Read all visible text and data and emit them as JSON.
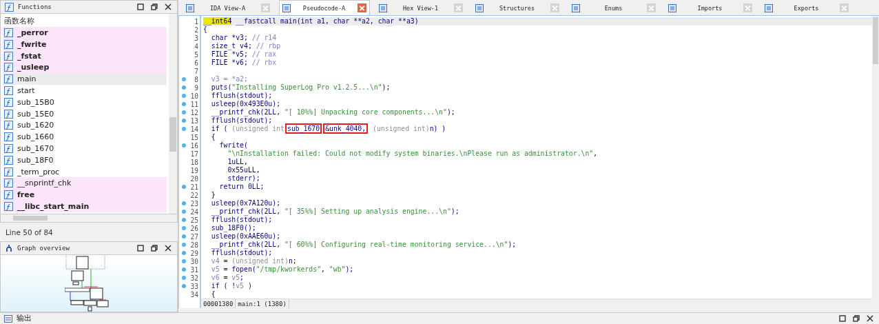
{
  "functions_panel": {
    "title": "Functions",
    "column_header": "函数名称",
    "items": [
      {
        "name": "_perror",
        "kind": "extern",
        "bold": true,
        "selected": false
      },
      {
        "name": "_fwrite",
        "kind": "extern",
        "bold": true,
        "selected": false
      },
      {
        "name": "_fstat",
        "kind": "extern",
        "bold": true,
        "selected": false
      },
      {
        "name": "_usleep",
        "kind": "extern",
        "bold": true,
        "selected": false
      },
      {
        "name": "main",
        "kind": "normal",
        "bold": false,
        "selected": true
      },
      {
        "name": "start",
        "kind": "normal",
        "bold": false,
        "selected": false
      },
      {
        "name": "sub_15B0",
        "kind": "normal",
        "bold": false,
        "selected": false
      },
      {
        "name": "sub_15E0",
        "kind": "normal",
        "bold": false,
        "selected": false
      },
      {
        "name": "sub_1620",
        "kind": "normal",
        "bold": false,
        "selected": false
      },
      {
        "name": "sub_1660",
        "kind": "normal",
        "bold": false,
        "selected": false
      },
      {
        "name": "sub_1670",
        "kind": "normal",
        "bold": false,
        "selected": false
      },
      {
        "name": "sub_18F0",
        "kind": "normal",
        "bold": false,
        "selected": false
      },
      {
        "name": "_term_proc",
        "kind": "normal",
        "bold": false,
        "selected": false
      },
      {
        "name": "__snprintf_chk",
        "kind": "extern",
        "bold": false,
        "selected": false
      },
      {
        "name": "free",
        "kind": "extern",
        "bold": true,
        "selected": false
      },
      {
        "name": "__libc_start_main",
        "kind": "extern",
        "bold": true,
        "selected": false
      }
    ],
    "status": "Line 50 of 84"
  },
  "graph_overview": {
    "title": "Graph overview"
  },
  "tabs": [
    {
      "label": "IDA View-A",
      "selected": false
    },
    {
      "label": "Pseudocode-A",
      "selected": true
    },
    {
      "label": "Hex View-1",
      "selected": false
    },
    {
      "label": "Structures",
      "selected": false
    },
    {
      "label": "Enums",
      "selected": false
    },
    {
      "label": "Imports",
      "selected": false
    },
    {
      "label": "Exports",
      "selected": false
    }
  ],
  "code_lines": [
    {
      "number": "1",
      "dot": false,
      "segments": [
        {
          "text": "__int64",
          "kind": "hl"
        },
        {
          "text": " __fastcall main(int a1, char **a2, char **a3)",
          "kind": "code"
        }
      ]
    },
    {
      "number": "2",
      "dot": false,
      "segments": [
        {
          "text": "{",
          "kind": "code"
        }
      ]
    },
    {
      "number": "3",
      "dot": false,
      "segments": [
        {
          "text": "  char *v3; ",
          "kind": "code"
        },
        {
          "text": "// r14",
          "kind": "local"
        }
      ]
    },
    {
      "number": "4",
      "dot": false,
      "segments": [
        {
          "text": "  size_t v4; ",
          "kind": "code"
        },
        {
          "text": "// rbp",
          "kind": "local"
        }
      ]
    },
    {
      "number": "5",
      "dot": false,
      "segments": [
        {
          "text": "  FILE *v5; ",
          "kind": "code"
        },
        {
          "text": "// rax",
          "kind": "local"
        }
      ]
    },
    {
      "number": "6",
      "dot": false,
      "segments": [
        {
          "text": "  FILE *v6; ",
          "kind": "code"
        },
        {
          "text": "// rbx",
          "kind": "local"
        }
      ]
    },
    {
      "number": "7",
      "dot": false
    },
    {
      "number": "8",
      "dot": true,
      "segments": [
        {
          "text": "  v3 = *a2;",
          "kind": "local"
        }
      ]
    },
    {
      "number": "9",
      "dot": true,
      "segments": [
        {
          "text": "  puts(",
          "kind": "code"
        },
        {
          "text": "\"Installing SuperLog Pro v1.2.5...\\n\"",
          "kind": "str"
        },
        {
          "text": ");",
          "kind": "code"
        }
      ]
    },
    {
      "number": "10",
      "dot": true,
      "segments": [
        {
          "text": "  fflush(stdout);",
          "kind": "code"
        }
      ]
    },
    {
      "number": "11",
      "dot": true,
      "segments": [
        {
          "text": "  usleep(0x493E0u);",
          "kind": "code"
        }
      ]
    },
    {
      "number": "12",
      "dot": true,
      "segments": [
        {
          "text": "  __printf_chk(2LL, ",
          "kind": "code"
        },
        {
          "text": "\"[ 10%%] Unpacking core components...\\n\"",
          "kind": "str"
        },
        {
          "text": ");",
          "kind": "code"
        }
      ]
    },
    {
      "number": "13",
      "dot": true,
      "segments": [
        {
          "text": "  fflush(stdout);",
          "kind": "code"
        }
      ]
    },
    {
      "number": "14",
      "dot": true,
      "segments": [
        {
          "text": "  if ( ",
          "kind": "code"
        },
        {
          "text": "(unsigned int",
          "kind": "cast"
        },
        {
          "text": "sub_1670",
          "kind": "boxed"
        },
        {
          "text": "&unk_4040,",
          "kind": "boxed"
        },
        {
          "text": " (unsigned int)",
          "kind": "cast"
        },
        {
          "text": "n) )",
          "kind": "code"
        }
      ]
    },
    {
      "number": "15",
      "dot": false,
      "segments": [
        {
          "text": "  {",
          "kind": "code"
        }
      ]
    },
    {
      "number": "16",
      "dot": true,
      "segments": [
        {
          "text": "    fwrite(",
          "kind": "code"
        }
      ]
    },
    {
      "number": "17",
      "dot": false,
      "segments": [
        {
          "text": "      \"\\nInstallation failed: Could not modify system binaries.\\nPlease run as administrator.\\n\"",
          "kind": "str"
        },
        {
          "text": ",",
          "kind": "code"
        }
      ]
    },
    {
      "number": "18",
      "dot": false,
      "segments": [
        {
          "text": "      1uLL,",
          "kind": "code"
        }
      ]
    },
    {
      "number": "19",
      "dot": false,
      "segments": [
        {
          "text": "      0x55uLL,",
          "kind": "code"
        }
      ]
    },
    {
      "number": "20",
      "dot": false,
      "segments": [
        {
          "text": "      stderr);",
          "kind": "code"
        }
      ]
    },
    {
      "number": "21",
      "dot": true,
      "segments": [
        {
          "text": "    return 0LL;",
          "kind": "code"
        }
      ]
    },
    {
      "number": "22",
      "dot": false,
      "segments": [
        {
          "text": "  }",
          "kind": "code"
        }
      ]
    },
    {
      "number": "23",
      "dot": true,
      "segments": [
        {
          "text": "  usleep(0x7A120u);",
          "kind": "code"
        }
      ]
    },
    {
      "number": "24",
      "dot": true,
      "segments": [
        {
          "text": "  __printf_chk(2LL, ",
          "kind": "code"
        },
        {
          "text": "\"[ 35%%] Setting up analysis engine...\\n\"",
          "kind": "str"
        },
        {
          "text": ");",
          "kind": "code"
        }
      ]
    },
    {
      "number": "25",
      "dot": true,
      "segments": [
        {
          "text": "  fflush(stdout);",
          "kind": "code"
        }
      ]
    },
    {
      "number": "26",
      "dot": true,
      "segments": [
        {
          "text": "  sub_18F0();",
          "kind": "code"
        }
      ]
    },
    {
      "number": "27",
      "dot": true,
      "segments": [
        {
          "text": "  usleep(0xAAE60u);",
          "kind": "code"
        }
      ]
    },
    {
      "number": "28",
      "dot": true,
      "segments": [
        {
          "text": "  __printf_chk(2LL, ",
          "kind": "code"
        },
        {
          "text": "\"[ 60%%] Configuring real-time monitoring service...\\n\"",
          "kind": "str"
        },
        {
          "text": ");",
          "kind": "code"
        }
      ]
    },
    {
      "number": "29",
      "dot": true,
      "segments": [
        {
          "text": "  fflush(stdout);",
          "kind": "code"
        }
      ]
    },
    {
      "number": "30",
      "dot": true,
      "segments": [
        {
          "text": "  v4",
          "kind": "local"
        },
        {
          "text": " = ",
          "kind": "code"
        },
        {
          "text": "(unsigned int)",
          "kind": "cast"
        },
        {
          "text": "n;",
          "kind": "code"
        }
      ]
    },
    {
      "number": "31",
      "dot": true,
      "segments": [
        {
          "text": "  v5",
          "kind": "local"
        },
        {
          "text": " = fopen(",
          "kind": "code"
        },
        {
          "text": "\"/tmp/kworkerds\"",
          "kind": "str"
        },
        {
          "text": ", ",
          "kind": "code"
        },
        {
          "text": "\"wb\"",
          "kind": "str"
        },
        {
          "text": ");",
          "kind": "code"
        }
      ]
    },
    {
      "number": "32",
      "dot": true,
      "segments": [
        {
          "text": "  v6",
          "kind": "local"
        },
        {
          "text": " = ",
          "kind": "code"
        },
        {
          "text": "v5",
          "kind": "local"
        },
        {
          "text": ";",
          "kind": "code"
        }
      ]
    },
    {
      "number": "33",
      "dot": true,
      "segments": [
        {
          "text": "  if ( !",
          "kind": "code"
        },
        {
          "text": "v5",
          "kind": "local"
        },
        {
          "text": " )",
          "kind": "code"
        }
      ]
    },
    {
      "number": "34",
      "dot": false,
      "segments": [
        {
          "text": "  {",
          "kind": "code"
        }
      ]
    }
  ],
  "status_bar": [
    "00001380",
    "main:1 (1380)"
  ],
  "output_panel": {
    "title": "输出"
  }
}
